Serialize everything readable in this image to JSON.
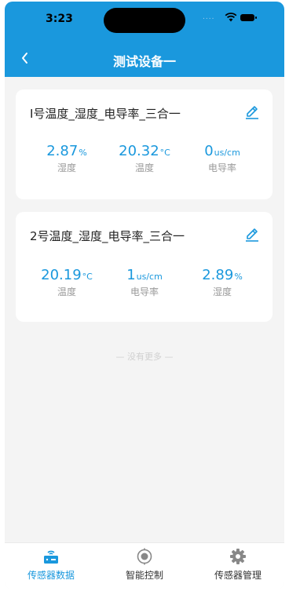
{
  "status_bar": {
    "time": "3:23",
    "dots": "...."
  },
  "header": {
    "title": "测试设备一"
  },
  "cards": [
    {
      "name": "Ⅰ号温度_湿度_电导率_三合一",
      "readings": [
        {
          "value": "2.87",
          "unit": "%",
          "label": "湿度"
        },
        {
          "value": "20.32",
          "unit": "°C",
          "label": "温度"
        },
        {
          "value": "0",
          "unit": "us/cm",
          "label": "电导率"
        }
      ]
    },
    {
      "name": "2号温度_湿度_电导率_三合一",
      "readings": [
        {
          "value": "20.19",
          "unit": "°C",
          "label": "温度"
        },
        {
          "value": "1",
          "unit": "us/cm",
          "label": "电导率"
        },
        {
          "value": "2.89",
          "unit": "%",
          "label": "湿度"
        }
      ]
    }
  ],
  "no_more": "— 没有更多 —",
  "tabs": [
    {
      "label": "传感器数据",
      "icon": "sensor-data-icon",
      "active": true
    },
    {
      "label": "智能控制",
      "icon": "smart-control-icon",
      "active": false
    },
    {
      "label": "传感器管理",
      "icon": "gear-icon",
      "active": false
    }
  ],
  "colors": {
    "primary": "#1a98dd",
    "background": "#f4f4f4",
    "label_gray": "#999999"
  }
}
